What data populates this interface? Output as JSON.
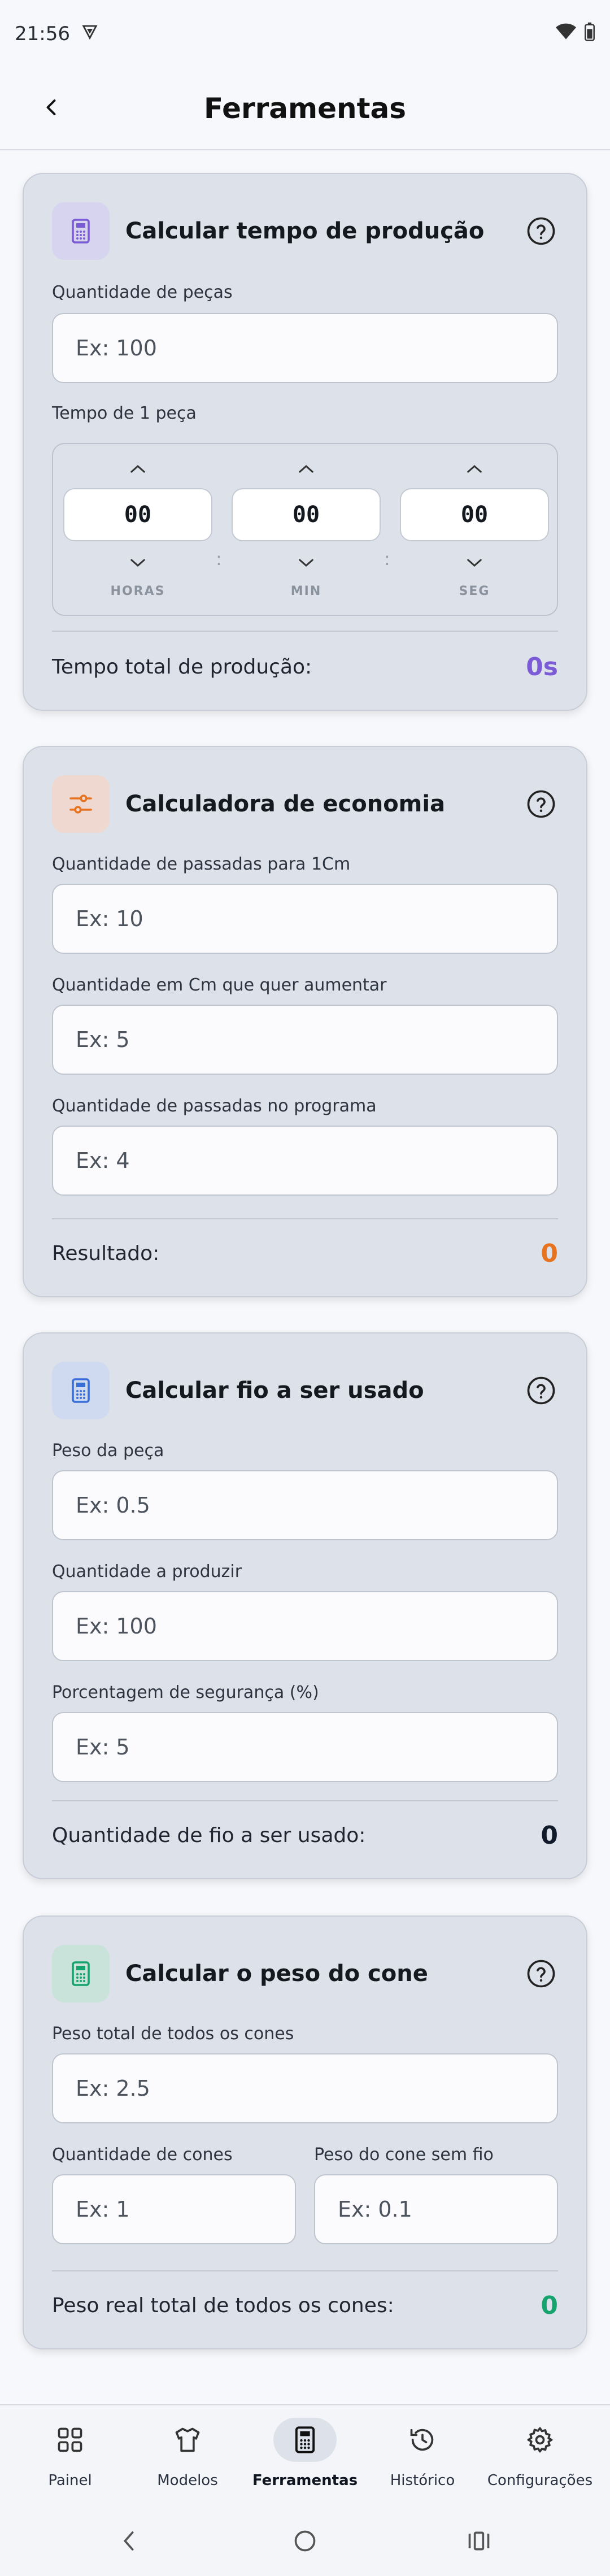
{
  "status_bar": {
    "time": "21:56"
  },
  "header": {
    "title": "Ferramentas"
  },
  "cards": {
    "production": {
      "title": "Calcular tempo de produção",
      "pieces_label": "Quantidade de peças",
      "pieces_placeholder": "Ex: 100",
      "time_label": "Tempo de 1 peça",
      "hours_value": "00",
      "minutes_value": "00",
      "seconds_value": "00",
      "hours_unit": "HORAS",
      "minutes_unit": "MIN",
      "seconds_unit": "SEG",
      "separator": ":",
      "result_label": "Tempo total de produção:",
      "result_value": "0s",
      "accent": "#7c5cd6"
    },
    "economy": {
      "title": "Calculadora de economia",
      "passes_label": "Quantidade de passadas para 1Cm",
      "passes_placeholder": "Ex: 10",
      "cm_label": "Quantidade em Cm que quer aumentar",
      "cm_placeholder": "Ex: 5",
      "program_label": "Quantidade de passadas no programa",
      "program_placeholder": "Ex: 4",
      "result_label": "Resultado:",
      "result_value": "0",
      "accent": "#e8731f"
    },
    "yarn": {
      "title": "Calcular fio a ser usado",
      "weight_label": "Peso da peça",
      "weight_placeholder": "Ex: 0.5",
      "qty_label": "Quantidade a produzir",
      "qty_placeholder": "Ex: 100",
      "safety_label": "Porcentagem de segurança (%)",
      "safety_placeholder": "Ex: 5",
      "result_label": "Quantidade de fio a ser usado:",
      "result_value": "0",
      "accent": "#3b6fd8"
    },
    "cone": {
      "title": "Calcular o peso do cone",
      "total_label": "Peso total de todos os cones",
      "total_placeholder": "Ex: 2.5",
      "count_label": "Quantidade de cones",
      "count_placeholder": "Ex: 1",
      "empty_label": "Peso do cone sem fio",
      "empty_placeholder": "Ex: 0.1",
      "result_label": "Peso real total de todos os cones:",
      "result_value": "0",
      "accent": "#17a36e"
    }
  },
  "bottom_nav": {
    "items": [
      {
        "label": "Painel",
        "icon": "grid-icon"
      },
      {
        "label": "Modelos",
        "icon": "shirt-icon"
      },
      {
        "label": "Ferramentas",
        "icon": "calculator-icon",
        "active": true
      },
      {
        "label": "Histórico",
        "icon": "history-icon"
      },
      {
        "label": "Configurações",
        "icon": "gear-icon"
      }
    ]
  }
}
